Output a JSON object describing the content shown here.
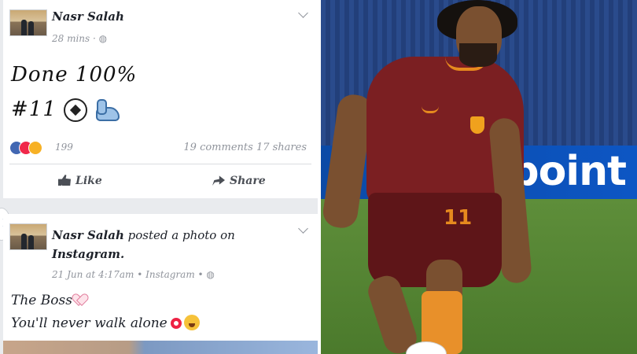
{
  "post1": {
    "author": "Nasr Salah",
    "meta": "28 mins",
    "line1": "Done 100%",
    "line2": "#11",
    "reactions_count": "199",
    "comments": "19 comments",
    "shares": "17 shares",
    "like_label": "Like",
    "share_label": "Share"
  },
  "post2": {
    "author": "Nasr Salah",
    "action": "posted a photo on",
    "app": "Instagram.",
    "meta": "21 Jun at 4:17am • Instagram •",
    "line1": "The Boss",
    "line2": "You'll never walk alone"
  },
  "photo": {
    "banner_text": "ypoint",
    "jersey_number": "11"
  },
  "colors": {
    "fb_blue": "#4267b2",
    "meta_gray": "#90949c",
    "jersey": "#7b1f22",
    "accent_orange": "#e68a1e"
  }
}
